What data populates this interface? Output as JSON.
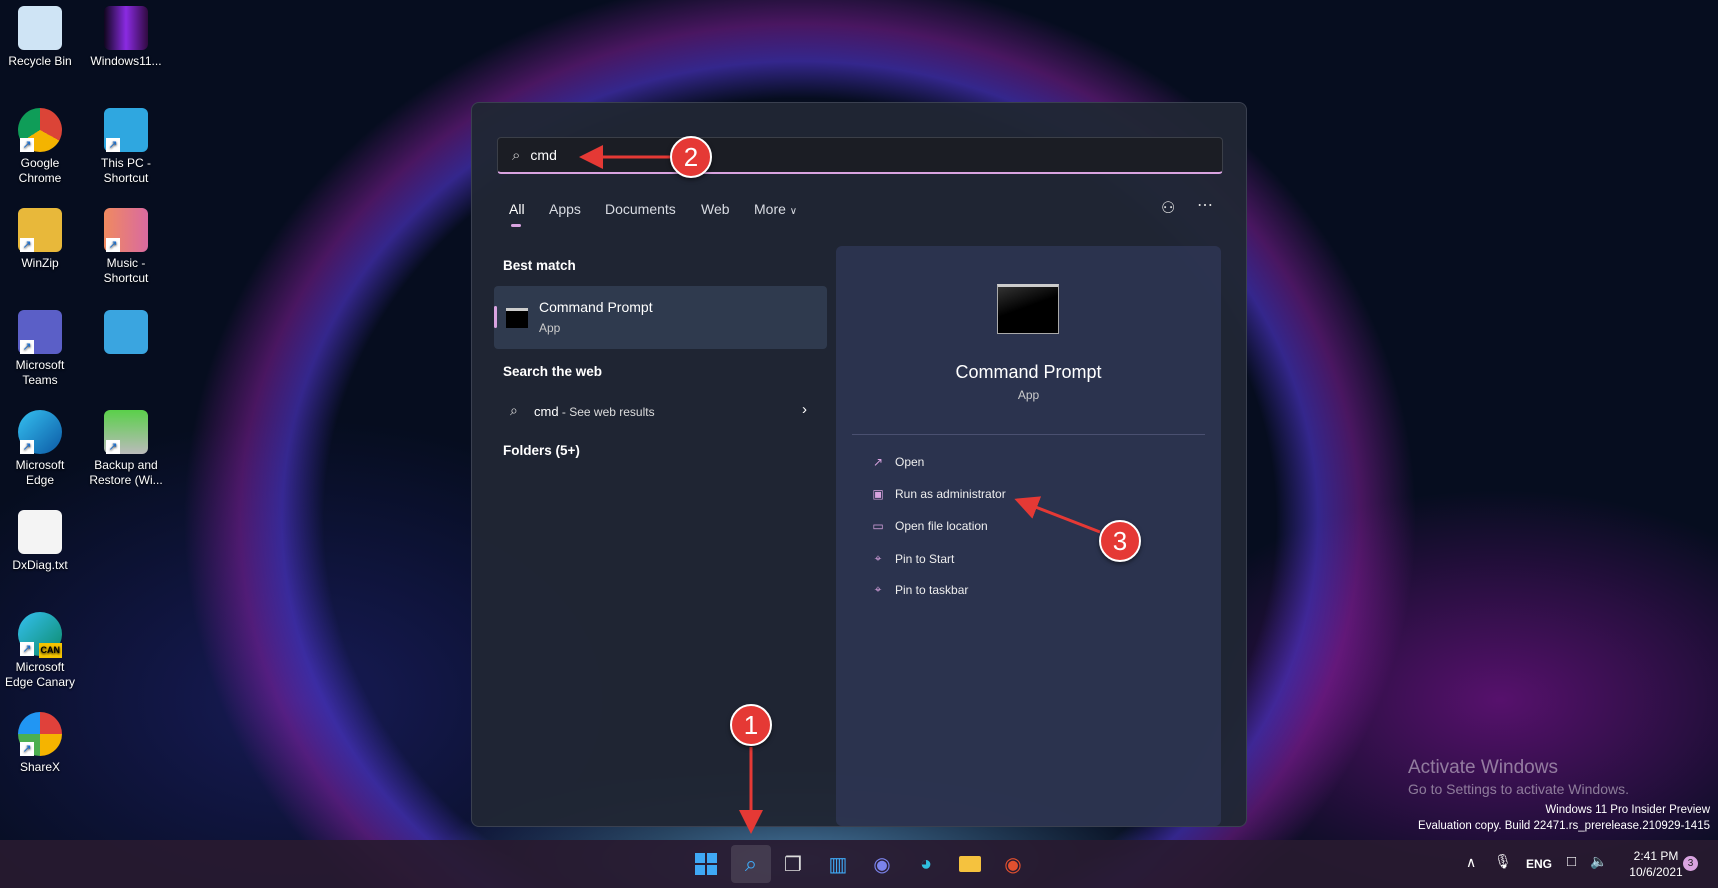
{
  "desktop": {
    "icons": [
      {
        "label": "Recycle Bin",
        "icon": "recycle-bin-icon"
      },
      {
        "label": "Windows11...",
        "icon": "image-file-icon"
      },
      {
        "label": "Google Chrome",
        "icon": "chrome-icon"
      },
      {
        "label": "This PC - Shortcut",
        "icon": "monitor-icon"
      },
      {
        "label": "WinZip",
        "icon": "winzip-icon"
      },
      {
        "label": "Music - Shortcut",
        "icon": "music-folder-icon"
      },
      {
        "label": "Microsoft Teams",
        "icon": "teams-icon"
      },
      {
        "label": "",
        "icon": "control-panel-icon"
      },
      {
        "label": "Microsoft Edge",
        "icon": "edge-icon"
      },
      {
        "label": "Backup and Restore (Wi...",
        "icon": "backup-icon"
      },
      {
        "label": "DxDiag.txt",
        "icon": "text-file-icon"
      },
      {
        "label": "Microsoft Edge Canary",
        "icon": "edge-canary-icon",
        "badge": "CAN"
      },
      {
        "label": "ShareX",
        "icon": "sharex-icon"
      }
    ]
  },
  "search": {
    "value": "cmd"
  },
  "tabs": [
    "All",
    "Apps",
    "Documents",
    "Web",
    "More"
  ],
  "left": {
    "best_match": "Best match",
    "result_title": "Command Prompt",
    "result_type": "App",
    "search_web": "Search the web",
    "web_query": "cmd",
    "web_suffix": " - See web results",
    "folders": "Folders (5+)"
  },
  "right": {
    "title": "Command Prompt",
    "type": "App",
    "actions": [
      "Open",
      "Run as administrator",
      "Open file location",
      "Pin to Start",
      "Pin to taskbar"
    ]
  },
  "annotations": [
    "1",
    "2",
    "3"
  ],
  "watermark": {
    "title": "Activate Windows",
    "subtitle": "Go to Settings to activate Windows.",
    "edition": "Windows 11 Pro Insider Preview",
    "build": "Evaluation copy. Build 22471.rs_prerelease.210929-1415"
  },
  "tray": {
    "lang": "ENG",
    "time": "2:41 PM",
    "date": "10/6/2021",
    "notifications": "3"
  }
}
